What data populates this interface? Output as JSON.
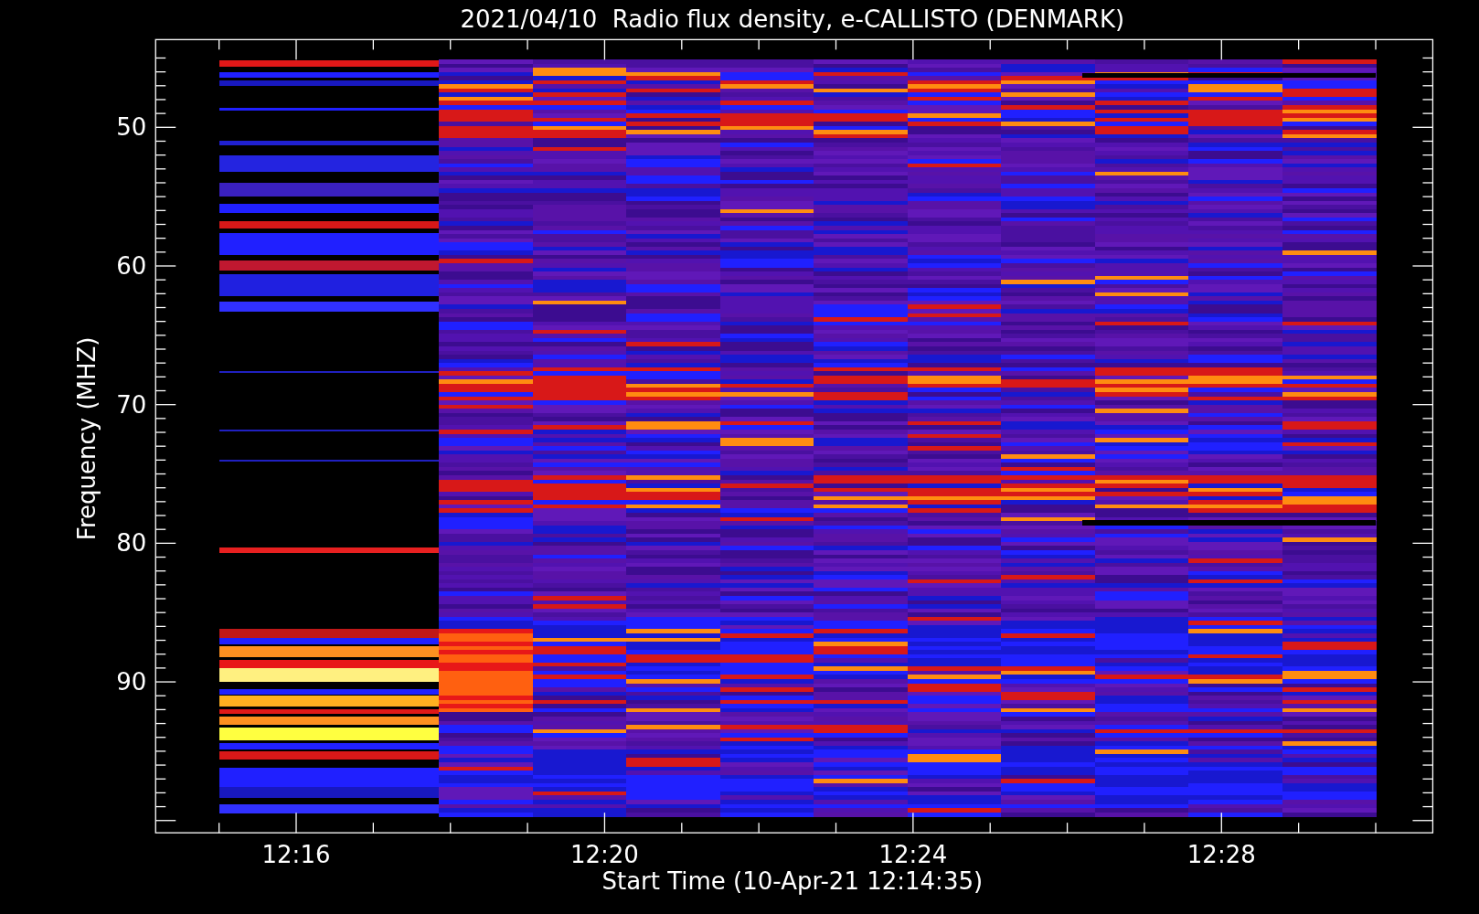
{
  "title": "2021/04/10  Radio flux density, e-CALLISTO (DENMARK)",
  "y_axis": {
    "label": "Frequency (MHZ)",
    "ticks": [
      "50",
      "60",
      "70",
      "80",
      "90"
    ]
  },
  "x_axis": {
    "label": "Start Time (10-Apr-21 12:14:35)",
    "ticks": [
      "12:16",
      "12:20",
      "12:24",
      "12:28"
    ]
  }
}
